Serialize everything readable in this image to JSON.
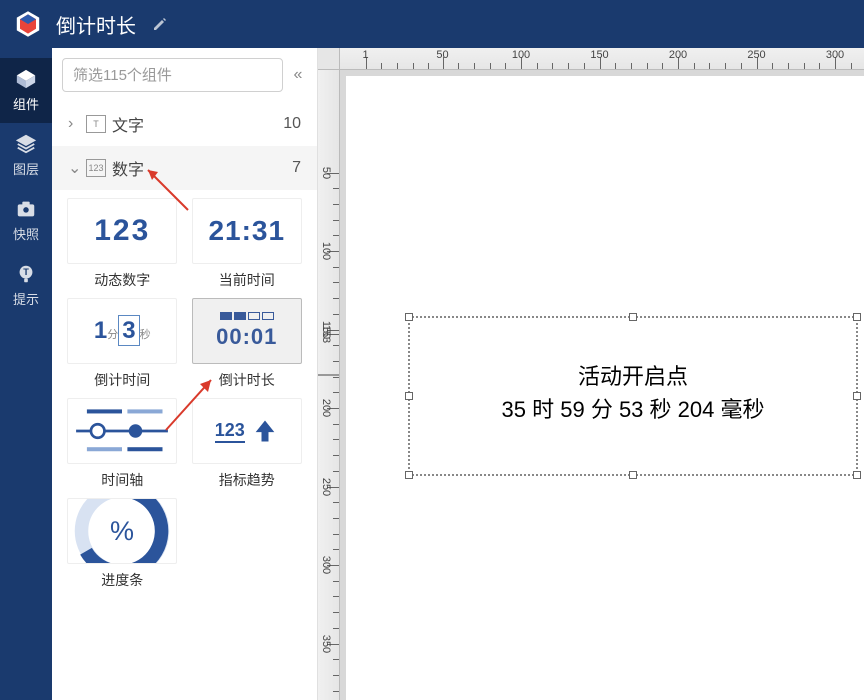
{
  "header": {
    "title": "倒计时长"
  },
  "nav": {
    "items": [
      {
        "label": "组件"
      },
      {
        "label": "图层"
      },
      {
        "label": "快照"
      },
      {
        "label": "提示"
      }
    ]
  },
  "sidebar": {
    "filter_placeholder": "筛选115个组件",
    "categories": [
      {
        "icon": "T",
        "label": "文字",
        "count": "10",
        "expanded": false
      },
      {
        "icon": "123",
        "label": "数字",
        "count": "7",
        "expanded": true
      }
    ],
    "components": [
      {
        "label": "动态数字"
      },
      {
        "label": "当前时间"
      },
      {
        "label": "倒计时间"
      },
      {
        "label": "倒计时长",
        "selected": true
      },
      {
        "label": "时间轴"
      },
      {
        "label": "指标趋势"
      },
      {
        "label": "进度条"
      }
    ],
    "previews": {
      "dynamic_number": "123",
      "current_time": "21:31",
      "countdown_timer": {
        "a": "1",
        "unit_a": "分",
        "b": "3",
        "unit_b": "秒"
      },
      "countdown_duration": "00:01",
      "trend_number": "123"
    }
  },
  "canvas": {
    "element": {
      "line1": "活动开启点",
      "line2": "35 时 59 分 53 秒 204 毫秒"
    },
    "ruler_h": [
      "1",
      "50",
      "100",
      "150",
      "200",
      "250",
      "300"
    ],
    "ruler_v": [
      "50",
      "100",
      "150",
      "153",
      "200",
      "250",
      "300",
      "350"
    ]
  }
}
